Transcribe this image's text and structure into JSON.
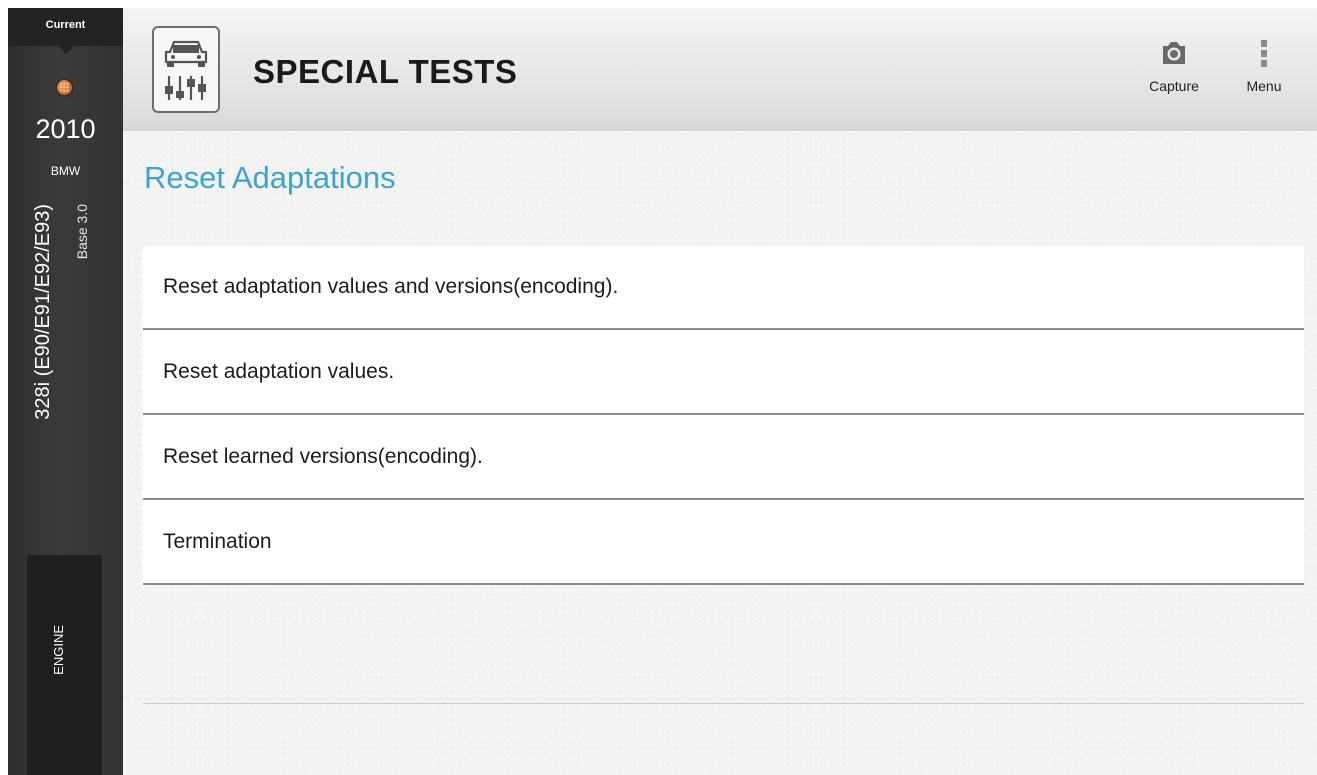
{
  "sidebar": {
    "current_label": "Current",
    "year": "2010",
    "make": "BMW",
    "model": "328i (E90/E91/E92/E93)",
    "engine": "Base 3.0",
    "system": "ENGINE",
    "status_dot_color": "#d8712c"
  },
  "header": {
    "title": "SPECIAL TESTS",
    "app_icon": "car-tuning-icon",
    "capture_label": "Capture",
    "capture_icon": "camera-icon",
    "menu_label": "Menu",
    "menu_icon": "vertical-dots-icon"
  },
  "main": {
    "section_title": "Reset Adaptations",
    "accent_color": "#3ea3cf",
    "items": [
      {
        "label": "Reset adaptation values and versions(encoding)."
      },
      {
        "label": "Reset adaptation values."
      },
      {
        "label": "Reset learned versions(encoding)."
      },
      {
        "label": "Termination"
      }
    ]
  }
}
